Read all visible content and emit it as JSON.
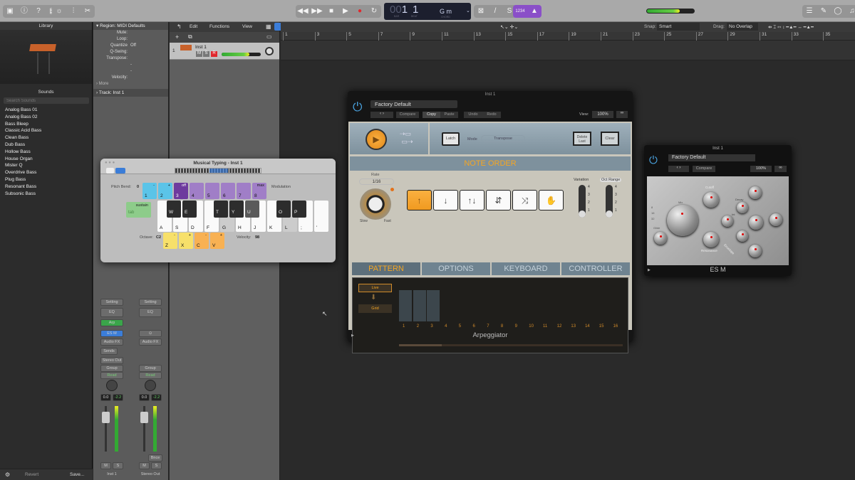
{
  "toolbar": {
    "transport_icons": [
      "rewind-icon",
      "fast-forward-icon",
      "stop-icon",
      "play-icon",
      "record-icon",
      "cycle-icon"
    ],
    "lcd": {
      "bar_prefix": "00",
      "bar": "1",
      "beat": "1",
      "bar_label": "BAR",
      "beat_label": "BEAT",
      "chord": "G m",
      "chord_label": "CHORD"
    },
    "count_in": "1234"
  },
  "library": {
    "title": "Library",
    "sounds_title": "Sounds",
    "search_placeholder": "Search Sounds",
    "sounds": [
      "Analog Bass 01",
      "Analog Bass 02",
      "Bass Bleep",
      "Classic Acid Bass",
      "Clean Bass",
      "Dub Bass",
      "Hollow Bass",
      "House Organ",
      "Mister Q",
      "Overdrive Bass",
      "Plug Bass",
      "Resonant Bass",
      "Subsonic Bass"
    ],
    "revert": "Revert",
    "save": "Save..."
  },
  "inspector": {
    "region_title": "Region: MIDI Defaults",
    "rows": [
      {
        "label": "Mute:",
        "value": ""
      },
      {
        "label": "Loop:",
        "value": ""
      },
      {
        "label": "Quantize",
        "value": "Off"
      },
      {
        "label": "Q-Swing:",
        "value": ""
      },
      {
        "label": "Transpose:",
        "value": ""
      },
      {
        "label": "",
        "value": "-"
      },
      {
        "label": "",
        "value": "-"
      },
      {
        "label": "Velocity:",
        "value": ""
      }
    ],
    "more": "More",
    "track_title": "Track:  Inst 1"
  },
  "channel_strips": [
    {
      "setting": "Setting",
      "eq": "EQ",
      "midi_fx": "Arp",
      "instrument": "ES M",
      "audio_fx": "Audio FX",
      "sends": "Sends",
      "output": "Stereo Out",
      "group": "Group",
      "automation": "Read",
      "volume": "0.0",
      "peak": "-2.2",
      "mute": "M",
      "solo": "S",
      "name": "Inst 1"
    },
    {
      "setting": "Setting",
      "eq": "EQ",
      "midi_fx": "",
      "instrument": "",
      "audio_fx": "Audio FX",
      "sends": "",
      "output": "",
      "group": "Group",
      "automation": "Read",
      "volume": "0.0",
      "peak": "-2.2",
      "mute": "M",
      "solo": "S",
      "name": "Stereo Out",
      "bounce": "Bnce"
    }
  ],
  "tracks_toolbar": {
    "edit": "Edit",
    "functions": "Functions",
    "view": "View",
    "snap_label": "Snap:",
    "snap": "Smart",
    "drag_label": "Drag:",
    "drag": "No Overlap"
  },
  "track": {
    "number": "1",
    "name": "Inst 1",
    "mute": "M",
    "solo": "S",
    "record": "R",
    "volume_level": 0.7
  },
  "ruler": [
    "1",
    "3",
    "5",
    "7",
    "9",
    "11",
    "13",
    "15",
    "17",
    "19",
    "21",
    "23",
    "25",
    "27",
    "29",
    "31",
    "33",
    "35"
  ],
  "musical_typing": {
    "title": "Musical Typing - Inst 1",
    "pitch_bend_label": "Pitch Bend:",
    "pitch_bend": "0",
    "modulation_label": "Modulation",
    "number_keys": [
      {
        "top": "-",
        "key": "1"
      },
      {
        "top": "+",
        "key": "2"
      },
      {
        "top": "off",
        "key": "3"
      },
      {
        "top": "",
        "key": "4"
      },
      {
        "top": "",
        "key": "5"
      },
      {
        "top": "",
        "key": "6"
      },
      {
        "top": "",
        "key": "7"
      },
      {
        "top": "max",
        "key": "8"
      }
    ],
    "sustain": "sustain",
    "tab": "tab",
    "white_keys": [
      "A",
      "S",
      "D",
      "F",
      "G",
      "H",
      "J",
      "K",
      "L",
      ";",
      "'"
    ],
    "black_keys": [
      {
        "key": "W",
        "pos": 0
      },
      {
        "key": "E",
        "pos": 1
      },
      {
        "key": "T",
        "pos": 3
      },
      {
        "key": "Y",
        "pos": 4
      },
      {
        "key": "U",
        "pos": 5
      },
      {
        "key": "O",
        "pos": 7
      },
      {
        "key": "P",
        "pos": 8
      }
    ],
    "octave_label": "Octave:",
    "octave": "C2",
    "octave_keys": [
      {
        "top": "-",
        "key": "Z"
      },
      {
        "top": "+",
        "key": "X"
      }
    ],
    "velocity_keys": [
      {
        "top": "-",
        "key": "C"
      },
      {
        "top": "+",
        "key": "V"
      }
    ],
    "velocity_label": "Velocity:",
    "velocity": "98"
  },
  "arpeggiator": {
    "window_title": "Inst 1",
    "preset": "Factory Default",
    "compare": "Compare",
    "copy": "Copy",
    "paste": "Paste",
    "undo": "Undo",
    "redo": "Redo",
    "view_label": "View:",
    "view": "100%",
    "latch": "Latch",
    "mode_label": "Mode",
    "mode": "Transpose",
    "delete_last": "Delete Last",
    "clear": "Clear",
    "note_order": "NOTE ORDER",
    "rate_label": "Rate",
    "rate": "1/16",
    "slow": "Slow",
    "fast": "Fast",
    "order_buttons": [
      "↑",
      "↓",
      "↑↓",
      "⇵",
      "⤨",
      "✋"
    ],
    "selected_order": 0,
    "variation_label": "Variation",
    "oct_range_label": "Oct Range",
    "slider_ticks": [
      "4",
      "3",
      "2",
      "1"
    ],
    "variation": 1,
    "oct_range": 1,
    "tabs": [
      "PATTERN",
      "OPTIONS",
      "KEYBOARD",
      "CONTROLLER"
    ],
    "active_tab": 0,
    "live": "Live",
    "grid": "Grid",
    "steps": [
      "1",
      "2",
      "3",
      "4",
      "5",
      "6",
      "7",
      "8",
      "9",
      "10",
      "11",
      "12",
      "13",
      "14",
      "15",
      "16"
    ],
    "active_steps": 3,
    "footer": "Arpeggiator"
  },
  "esm": {
    "window_title": "Inst 1",
    "preset": "Factory Default",
    "compare": "Compare",
    "view": "100%",
    "footer": "ES M",
    "labels": [
      "Cutoff",
      "Resonance",
      "Mix",
      "Glide",
      "Int",
      "Decay",
      "Velo",
      "Envelope"
    ],
    "octaves": [
      "8",
      "16",
      "32"
    ]
  },
  "colors": {
    "accent_orange": "#f5a623",
    "arp_blue": "#6f8390",
    "record_red": "#e0282d",
    "count_in_purple": "#8a4fc8",
    "ms_blue": "#3b7dd8",
    "arp_green": "#3aa54a"
  }
}
